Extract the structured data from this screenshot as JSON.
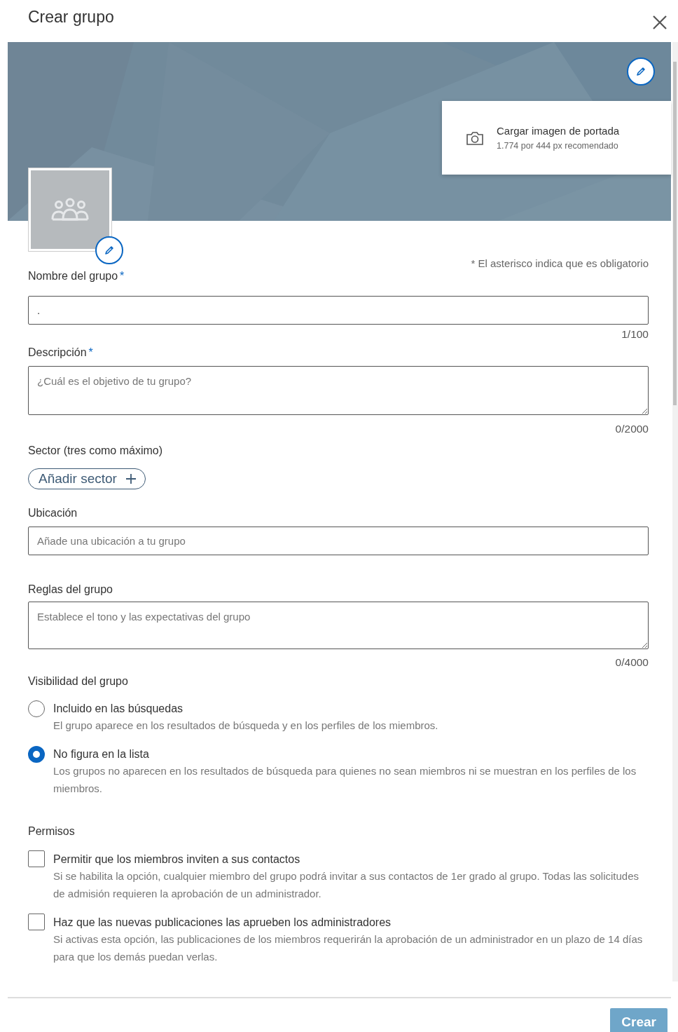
{
  "title": "Crear grupo",
  "cover_menu": {
    "title": "Cargar imagen de portada",
    "hint": "1.774 por 444 px recomendado"
  },
  "required_note": "* El asterisco indica que es obligatorio",
  "name_field": {
    "label": "Nombre del grupo",
    "required_mark": "*",
    "value": ".",
    "counter": "1/100"
  },
  "description": {
    "label": "Descripción",
    "required_mark": "*",
    "placeholder": "¿Cuál es el objetivo de tu grupo?",
    "counter": "0/2000"
  },
  "sector": {
    "label": "Sector (tres como máximo)",
    "button": "Añadir sector"
  },
  "location": {
    "label": "Ubicación",
    "placeholder": "Añade una ubicación a tu grupo"
  },
  "rules": {
    "label": "Reglas del grupo",
    "placeholder": "Establece el tono y las expectativas del grupo",
    "counter": "0/4000"
  },
  "visibility": {
    "label": "Visibilidad del grupo",
    "options": [
      {
        "title": "Incluido en las búsquedas",
        "description": "El grupo aparece en los resultados de búsqueda y en los perfiles de los miembros.",
        "selected": false
      },
      {
        "title": "No figura en la lista",
        "description": "Los grupos no aparecen en los resultados de búsqueda para quienes no sean miembros ni se muestran en los perfiles de los miembros.",
        "selected": true
      }
    ]
  },
  "permissions": {
    "label": "Permisos",
    "options": [
      {
        "title": "Permitir que los miembros inviten a sus contactos",
        "description": "Si se habilita la opción, cualquier miembro del grupo podrá invitar a sus contactos de 1er grado al grupo. Todas las solicitudes de admisión requieren la aprobación de un administrador.",
        "checked": false
      },
      {
        "title": "Haz que las nuevas publicaciones las aprueben los administradores",
        "description": "Si activas esta opción, las publicaciones de los miembros requerirán la aprobación de un administrador en un plazo de 14 días para que los demás puedan verlas.",
        "checked": false
      }
    ]
  },
  "submit": {
    "label": "Crear",
    "disabled": true
  }
}
